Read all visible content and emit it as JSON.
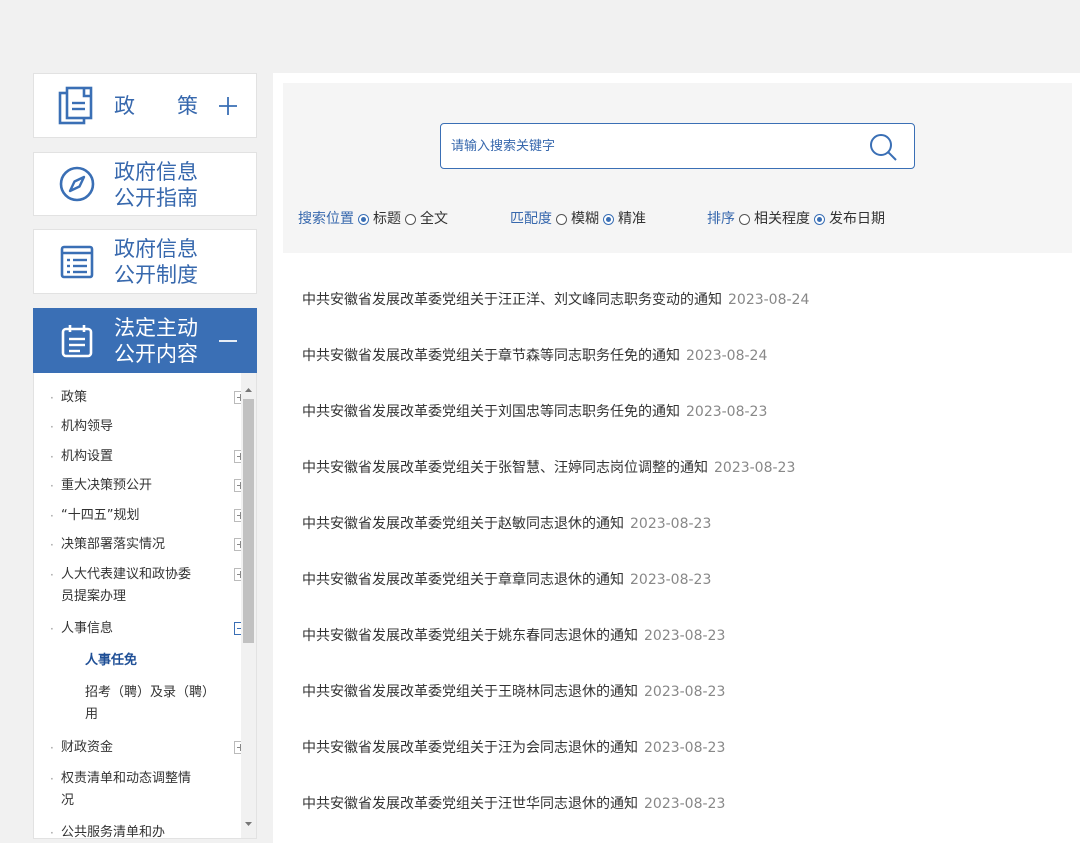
{
  "nav": {
    "policy": {
      "title": "政　　策",
      "icon": "document-stack-icon"
    },
    "guide": {
      "line1": "政府信息",
      "line2": "公开指南",
      "icon": "compass-icon"
    },
    "system": {
      "line1": "政府信息",
      "line2": "公开制度",
      "icon": "list-icon"
    },
    "legal": {
      "line1": "法定主动",
      "line2": "公开内容",
      "icon": "calendar-list-icon"
    }
  },
  "tree": {
    "items": [
      {
        "label": "政策",
        "expandable": true
      },
      {
        "label": "机构领导",
        "expandable": false
      },
      {
        "label": "机构设置",
        "expandable": true
      },
      {
        "label": "重大决策预公开",
        "expandable": true
      },
      {
        "label": "“十四五”规划",
        "expandable": true
      },
      {
        "label": "决策部署落实情况",
        "expandable": true
      },
      {
        "label": "人大代表建议和政协委员提案办理",
        "expandable": true
      },
      {
        "label": "人事信息",
        "expandable": true,
        "expanded": true
      },
      {
        "label": "财政资金",
        "expandable": true
      },
      {
        "label": "权责清单和动态调整情况",
        "expandable": false
      },
      {
        "label": "公共服务清单和办",
        "expandable": false
      }
    ],
    "children": [
      {
        "label": "人事任免",
        "active": true
      },
      {
        "label": "招考（聘）及录（聘）用",
        "active": false
      }
    ]
  },
  "search": {
    "placeholder": "请输入搜索关键字",
    "position": {
      "label": "搜索位置",
      "options": [
        "标题",
        "全文"
      ],
      "selected": "标题"
    },
    "match": {
      "label": "匹配度",
      "options": [
        "模糊",
        "精准"
      ],
      "selected": "精准"
    },
    "sort": {
      "label": "排序",
      "options": [
        "相关程度",
        "发布日期"
      ],
      "selected": "发布日期"
    }
  },
  "articles": [
    {
      "title": "中共安徽省发展改革委党组关于汪正洋、刘文峰同志职务变动的通知",
      "date": "2023-08-24"
    },
    {
      "title": "中共安徽省发展改革委党组关于章节森等同志职务任免的通知",
      "date": "2023-08-24"
    },
    {
      "title": "中共安徽省发展改革委党组关于刘国忠等同志职务任免的通知",
      "date": "2023-08-23"
    },
    {
      "title": "中共安徽省发展改革委党组关于张智慧、汪婷同志岗位调整的通知",
      "date": "2023-08-23"
    },
    {
      "title": "中共安徽省发展改革委党组关于赵敏同志退休的通知",
      "date": "2023-08-23"
    },
    {
      "title": "中共安徽省发展改革委党组关于章章同志退休的通知",
      "date": "2023-08-23"
    },
    {
      "title": "中共安徽省发展改革委党组关于姚东春同志退休的通知",
      "date": "2023-08-23"
    },
    {
      "title": "中共安徽省发展改革委党组关于王晓林同志退休的通知",
      "date": "2023-08-23"
    },
    {
      "title": "中共安徽省发展改革委党组关于汪为会同志退休的通知",
      "date": "2023-08-23"
    },
    {
      "title": "中共安徽省发展改革委党组关于汪世华同志退休的通知",
      "date": "2023-08-23"
    }
  ],
  "colors": {
    "accent": "#3a6fb5",
    "text_link": "#3768ad"
  }
}
